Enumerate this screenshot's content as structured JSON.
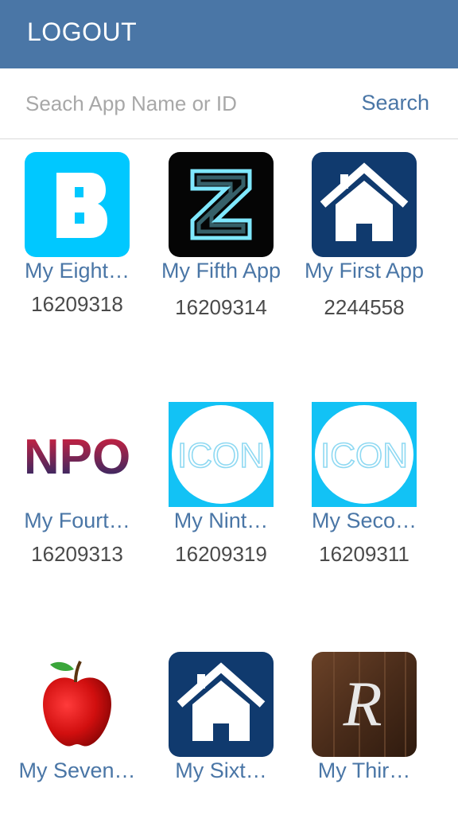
{
  "header": {
    "logout_label": "LOGOUT",
    "background": "#4a76a6"
  },
  "search": {
    "placeholder": "Seach App Name or ID",
    "button_label": "Search"
  },
  "apps": [
    {
      "name": "My Eight…",
      "id": "16209318",
      "icon": "letter-b-icon"
    },
    {
      "name": "My Fifth App",
      "id": "16209314",
      "icon": "neon-z-icon"
    },
    {
      "name": "My First App",
      "id": "2244558",
      "icon": "house-icon"
    },
    {
      "name": "My Fourt…",
      "id": "16209313",
      "icon": "npo-logo-icon"
    },
    {
      "name": "My Nint…",
      "id": "16209319",
      "icon": "icon-logo-icon"
    },
    {
      "name": "My Seco…",
      "id": "16209311",
      "icon": "icon-logo-icon"
    },
    {
      "name": "My Seven…",
      "id": "",
      "icon": "apple-icon"
    },
    {
      "name": "My Sixt…",
      "id": "",
      "icon": "house-icon"
    },
    {
      "name": "My Thir…",
      "id": "",
      "icon": "r-wood-icon"
    }
  ],
  "icon_labels": {
    "npo": "NPO",
    "icon": "ICON",
    "r": "R"
  }
}
